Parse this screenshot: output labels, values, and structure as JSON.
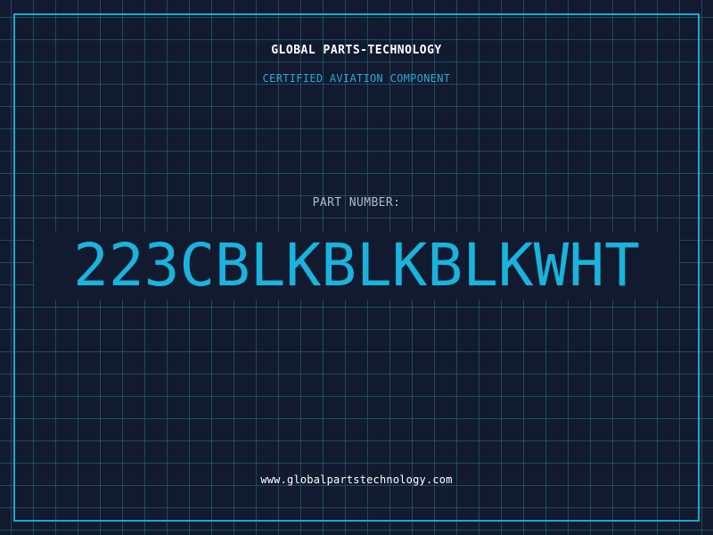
{
  "header": {
    "brand": "GLOBAL PARTS-TECHNOLOGY",
    "tagline": "CERTIFIED AVIATION COMPONENT"
  },
  "part": {
    "label": "PART NUMBER:",
    "number": "223CBLKBLKBLKWHT"
  },
  "footer": {
    "url": "www.globalpartstechnology.com"
  },
  "colors": {
    "background": "#111a2e",
    "grid": "#2b6f8a",
    "border": "#1aa7cf",
    "accent": "#19b3de"
  }
}
